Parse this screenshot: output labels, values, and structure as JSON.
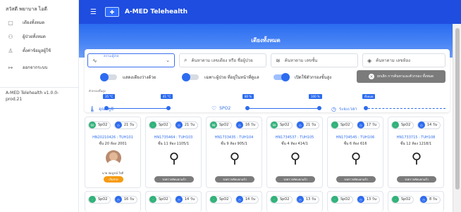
{
  "sidebar": {
    "user_name": "สวัสดี พยาบาล ไอดี",
    "items": [
      {
        "label": "เตียงทั้งหมด",
        "icon": "▢"
      },
      {
        "label": "ผู้ป่วยทั้งหมด",
        "icon": "⚇"
      },
      {
        "label": "ตั้งค่าข้อมูลผู้ใช้",
        "icon": "♙"
      },
      {
        "label": "ออกจากระบบ",
        "icon": "↦"
      }
    ],
    "version": "A-MED Telehealth v1.0.0-prod.21"
  },
  "topbar": {
    "app_name": "A-MED Telehealth",
    "menu_icon": "☰"
  },
  "page": {
    "title": "เตียงทั้งหมด"
  },
  "filters": {
    "status": {
      "mini_label": "สถานะผู้ป่วย",
      "icon": "∿"
    },
    "search_patient": {
      "placeholder": "ค้นหาตาม เลขเตียง หรือ ชื่อผู้ป่วย",
      "icon": "⌕"
    },
    "search_floor": {
      "placeholder": "ค้นหาตาม เลขชั้น",
      "icon": "≋"
    },
    "search_room": {
      "placeholder": "ค้นหาตาม เลขห้อง",
      "icon": "◈"
    },
    "toggle_show_all": "แสดงเตียงว่างด้วย",
    "toggle_my_patients": "เฉพาะผู้ป่วย ที่อยู่ในหน้าที่ดูแล",
    "toggle_advanced": "เปิดใช้ตัวกรองขั้นสูง",
    "reset_label": "ยกเลิก การค้นหาและตัวกรอง ทั้งหมด",
    "range_title": "ตัวกรองขั้นสูง",
    "temp_label": "อุณหภูมิ",
    "temp_min": "35 °C",
    "temp_max": "41 °C",
    "spo2_label": "SPO2",
    "spo2_min": "80 %",
    "spo2_max": "100 %",
    "time_label": "ระยะเวลา",
    "time_tag": "ทั้งหมด"
  },
  "cards": [
    {
      "days_badge": "60",
      "spo2": "SpO2",
      "days": "21 วัน",
      "hn": "HN20210426 : TUH101",
      "room": "ชั้น 20 ห้อง 2001",
      "doctor": "นาย สมบูรณ์ ใจดี",
      "status": "เริ่มป่วย"
    },
    {
      "days_badge": "-",
      "spo2": "SpO2",
      "days": "21 วัน",
      "hn": "HN1735464 : TUH103",
      "room": "ชั้น 11 ห้อง 1105/1",
      "doctor": "",
      "status": "รอตรวจคัดแยกแล้ว"
    },
    {
      "days_badge": "98",
      "spo2": "SpO2",
      "days": "16 วัน",
      "hn": "HN1733435 : TUH104",
      "room": "ชั้น 9 ห้อง 905/1",
      "doctor": "",
      "status": "รอตรวจคัดแยกแล้ว"
    },
    {
      "days_badge": "99",
      "spo2": "SpO2",
      "days": "21 วัน",
      "hn": "HN1734537 : TUH105",
      "room": "ชั้น 4 ห้อง 414/1",
      "doctor": "",
      "status": "รอตรวจคัดแยกแล้ว"
    },
    {
      "days_badge": "-",
      "spo2": "SpO2",
      "days": "17 วัน",
      "hn": "HN1734545 : TUH106",
      "room": "ชั้น 6 ห้อง 616",
      "doctor": "",
      "status": "รอตรวจคัดแยกแล้ว"
    },
    {
      "days_badge": "-",
      "spo2": "SpO2",
      "days": "14 วัน",
      "hn": "HN1733715 : TUH108",
      "room": "ชั้น 12 ห้อง 1218/1",
      "doctor": "",
      "status": "รอตรวจคัดแยกแล้ว"
    }
  ],
  "cards_row2": [
    {
      "days_badge": "-",
      "spo2": "SpO2",
      "days": "16 วัน"
    },
    {
      "days_badge": "-",
      "spo2": "SpO2",
      "days": "14 วัน"
    },
    {
      "days_badge": "-",
      "spo2": "SpO2",
      "days": "14 วัน"
    },
    {
      "days_badge": "-",
      "spo2": "SpO2",
      "days": "13 วัน"
    },
    {
      "days_badge": "-",
      "spo2": "SpO2",
      "days": "13 วัน"
    },
    {
      "days_badge": "-",
      "spo2": "SpO2",
      "days": "8 วัน"
    }
  ],
  "colors": {
    "primary": "#1e4de0",
    "accent": "#2d6cf0",
    "green": "#31b27a",
    "orange": "#f59b11",
    "grey": "#7b7b7b"
  }
}
